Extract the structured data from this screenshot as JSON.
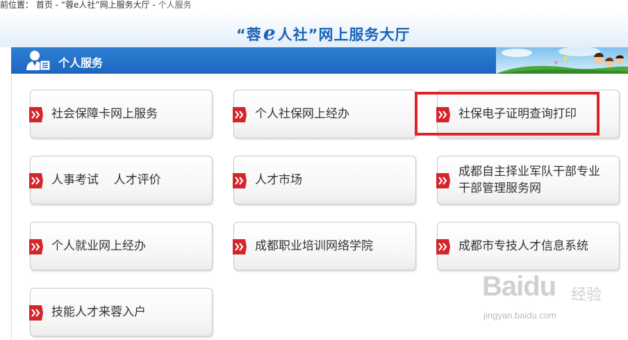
{
  "breadcrumb": {
    "prefix": "前位置：",
    "home": "首页",
    "sep1": " - ",
    "portal": "“蓉e人社”网上服务大厅",
    "sep2": " - ",
    "current": "个人服务"
  },
  "banner": {
    "title_before": "“蓉",
    "title_e": "e",
    "title_after": "人社”网上服务大厅"
  },
  "section": {
    "title": "个人服务",
    "icon": "user-profile-icon"
  },
  "services": [
    {
      "label": "社会保障卡网上服务"
    },
    {
      "label": "个人社保网上经办"
    },
    {
      "label": "社保电子证明查询打印"
    },
    {
      "label": "人事考试    人才评价"
    },
    {
      "label": "人才市场"
    },
    {
      "label": "成都自主择业军队干部专业\n干部管理服务网"
    },
    {
      "label": "个人就业网上经办"
    },
    {
      "label": "成都职业培训网络学院"
    },
    {
      "label": "成都市专技人才信息系统"
    },
    {
      "label": "技能人才来蓉入户"
    }
  ],
  "watermark": {
    "brand": "Baidu",
    "cn": "经验",
    "url": "jingyan.baidu.com"
  },
  "colors": {
    "section_bar": "#1d66bf",
    "title_blue": "#1a63b8",
    "arrow_red": "#d4252b",
    "highlight": "#e0232a"
  }
}
